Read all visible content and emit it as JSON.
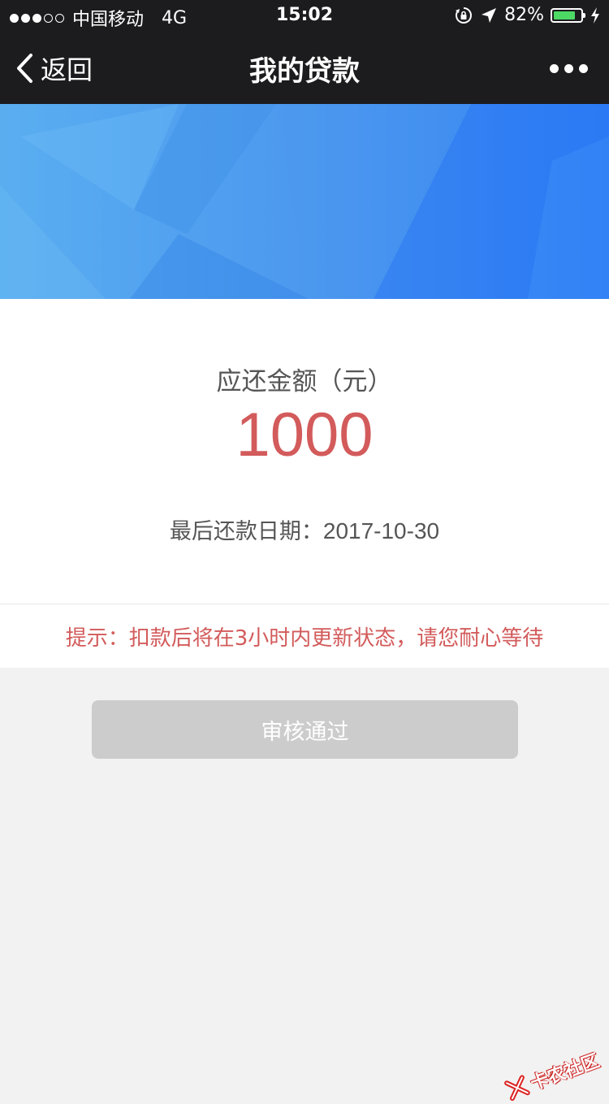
{
  "status_bar": {
    "carrier": "中国移动",
    "network": "4G",
    "time": "15:02",
    "battery_percent": "82%",
    "battery_level": 0.82,
    "battery_color": "#4cd964"
  },
  "nav": {
    "back_label": "返回",
    "title": "我的贷款",
    "back_icon": "chevron-left-icon",
    "more_icon": "more-dots-icon"
  },
  "loan": {
    "amount_label": "应还金额（元）",
    "amount": "1000",
    "due_label": "最后还款日期：",
    "due_date": "2017-10-30",
    "amount_color": "#d35b5b"
  },
  "notice": {
    "text": "提示：扣款后将在3小时内更新状态，请您耐心等待",
    "color": "#d35b5b"
  },
  "actions": {
    "approve_label": "审核通过"
  },
  "watermark": {
    "text": "卡农社区"
  }
}
